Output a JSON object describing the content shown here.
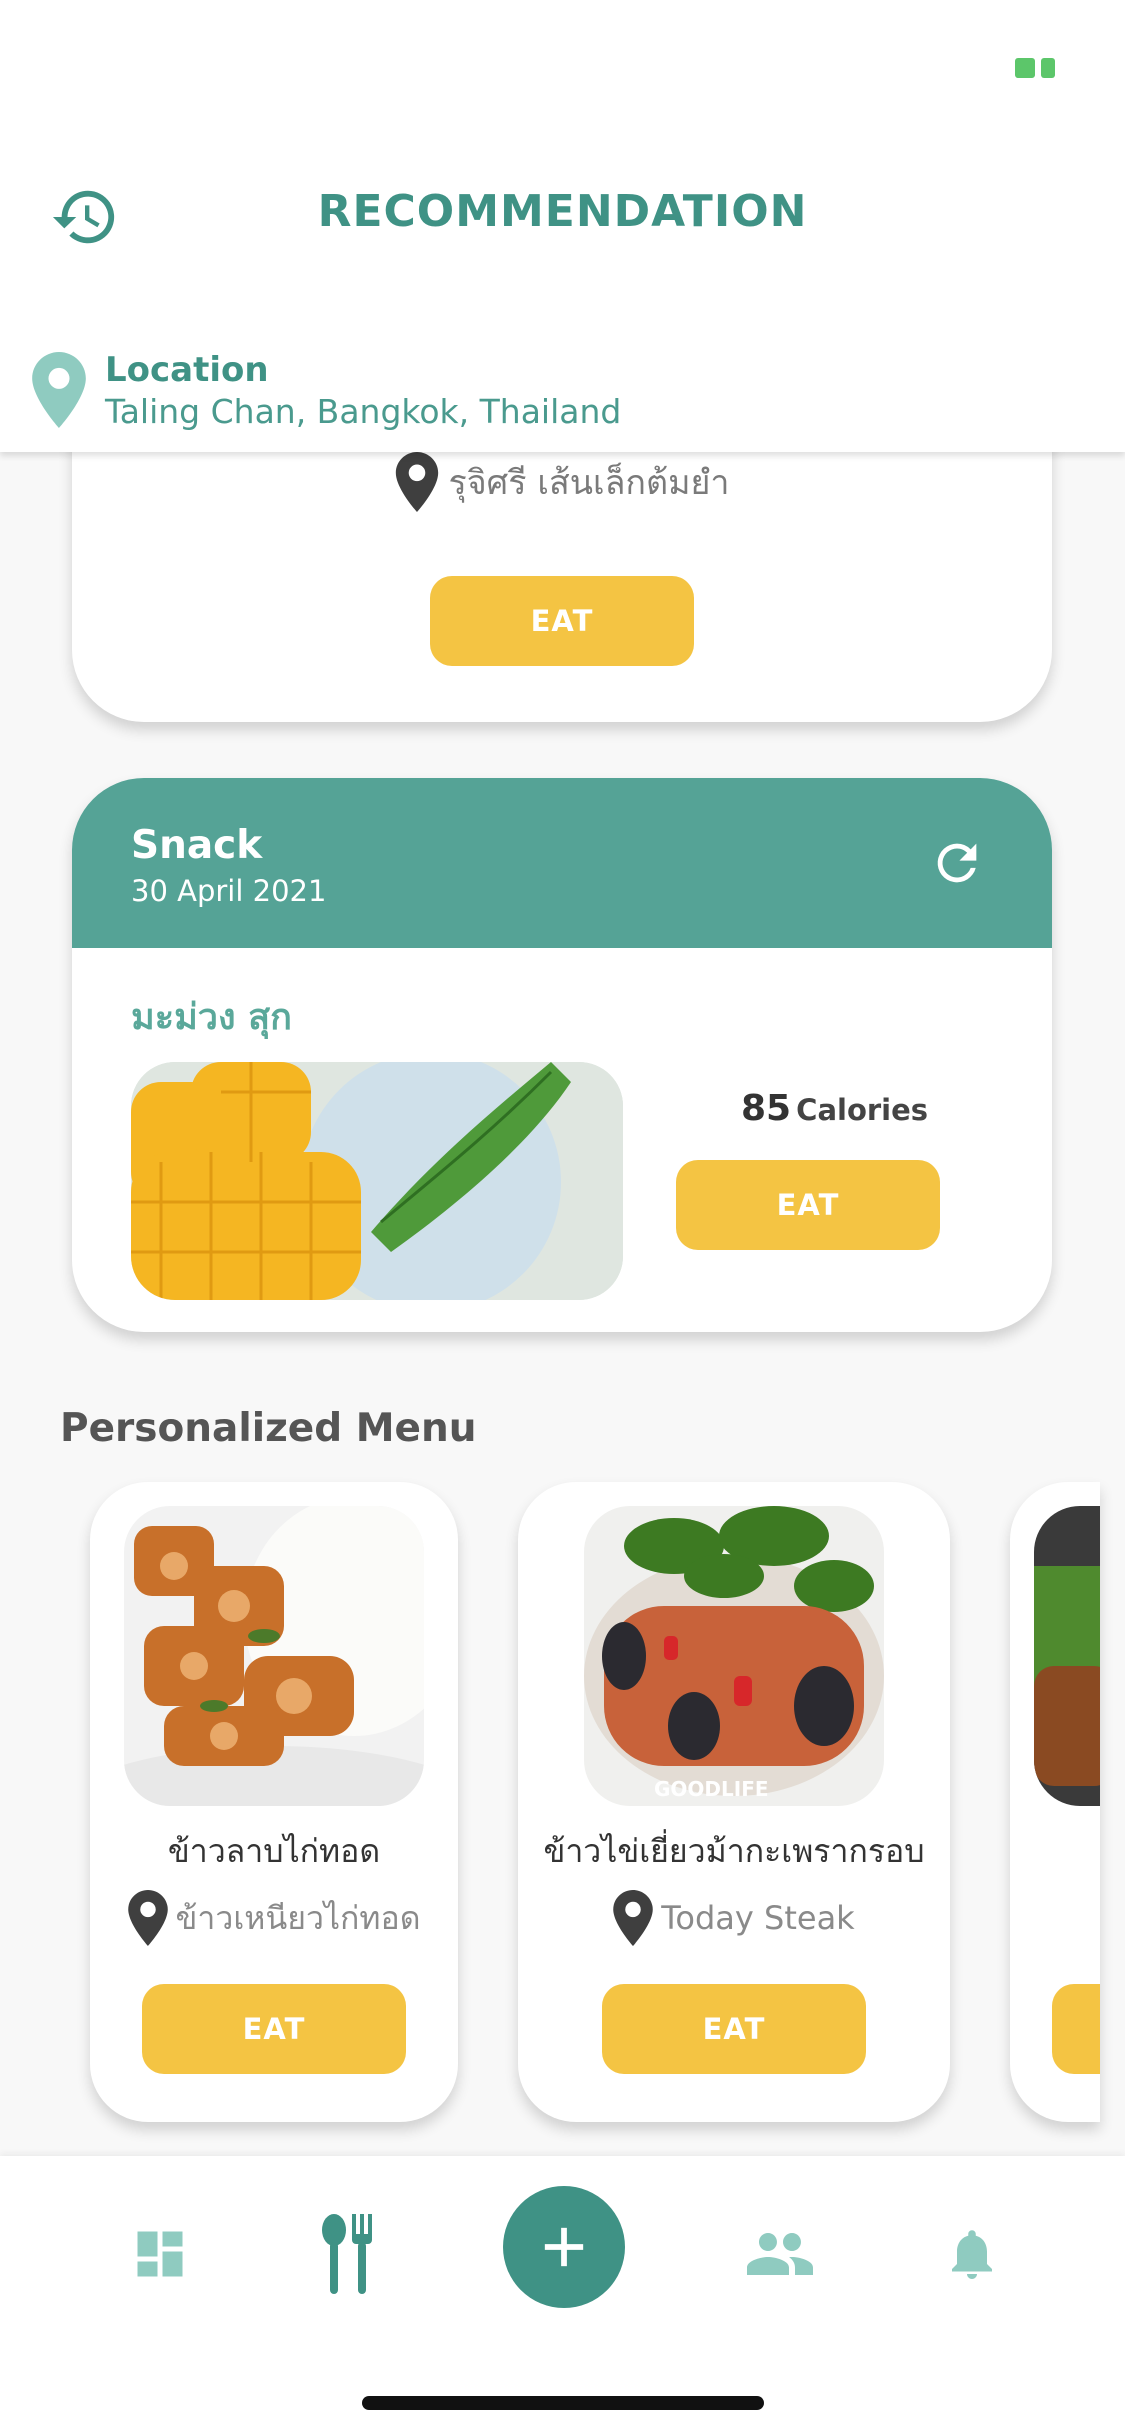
{
  "header": {
    "title": "RECOMMENDATION",
    "location_label": "Location",
    "location_value": "Taling Chan, Bangkok, Thailand"
  },
  "top_card": {
    "restaurant": "รุจิศรี เส้นเล็กต้มยำ",
    "eat_label": "EAT"
  },
  "snack_card": {
    "title": "Snack",
    "date": "30 April 2021",
    "food_name": "มะม่วง สุก",
    "calories_value": "85",
    "calories_unit": "Calories",
    "eat_label": "EAT"
  },
  "personalized": {
    "title": "Personalized Menu",
    "items": [
      {
        "name": "ข้าวลาบไก่ทอด",
        "place": "ข้าวเหนียวไก่ทอด",
        "eat_label": "EAT"
      },
      {
        "name": "ข้าวไข่เยี่ยวม้ากะเพรากรอบ",
        "place": "Today Steak",
        "eat_label": "EAT",
        "watermark": "GOODLIFE"
      }
    ]
  },
  "icons": {
    "history": "history-icon",
    "location": "location-pin-icon",
    "refresh": "refresh-icon",
    "nav": [
      "dashboard-icon",
      "food-icon",
      "add-icon",
      "community-icon",
      "bell-icon"
    ]
  },
  "colors": {
    "primary": "#3f9285",
    "header_green": "#55a396",
    "button_yellow": "#f4c443",
    "pin_teal": "#8fcbc0"
  }
}
